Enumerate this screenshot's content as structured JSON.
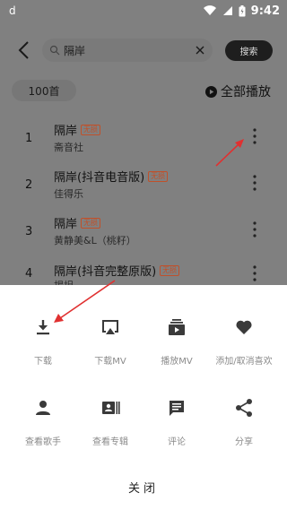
{
  "status_bar": {
    "app_glyph": "d",
    "time": "9:42",
    "icons": [
      "wifi-icon",
      "signal-icon",
      "battery-icon"
    ]
  },
  "header": {
    "back_icon": "chevron-left-icon",
    "search_value": "隔岸",
    "search_button": "搜索"
  },
  "list_header": {
    "count": "100首",
    "play_all": "全部播放"
  },
  "songs": [
    {
      "index": "1",
      "title": "隔岸",
      "badge": "无损",
      "artist": "斋音社"
    },
    {
      "index": "2",
      "title": "隔岸(抖音电音版)",
      "badge": "无损",
      "artist": "佳得乐"
    },
    {
      "index": "3",
      "title": "隔岸",
      "badge": "无损",
      "artist": "黄静美&L（桃籽）"
    },
    {
      "index": "4",
      "title": "隔岸(抖音完整原版)",
      "badge": "无损",
      "artist": "揭坦"
    }
  ],
  "sheet": {
    "actions": [
      {
        "label": "下载",
        "icon": "download-icon"
      },
      {
        "label": "下载MV",
        "icon": "airplay-icon"
      },
      {
        "label": "播放MV",
        "icon": "video-play-icon"
      },
      {
        "label": "添加/取消喜欢",
        "icon": "heart-icon"
      },
      {
        "label": "查看歌手",
        "icon": "person-icon"
      },
      {
        "label": "查看专辑",
        "icon": "album-icon"
      },
      {
        "label": "评论",
        "icon": "comment-icon"
      },
      {
        "label": "分享",
        "icon": "share-icon"
      }
    ],
    "close": "关闭"
  },
  "colors": {
    "overlay": "#808080",
    "annotation_arrow": "#e03030",
    "badge": "#c0502a",
    "sheet_label": "#8a8a8a"
  }
}
